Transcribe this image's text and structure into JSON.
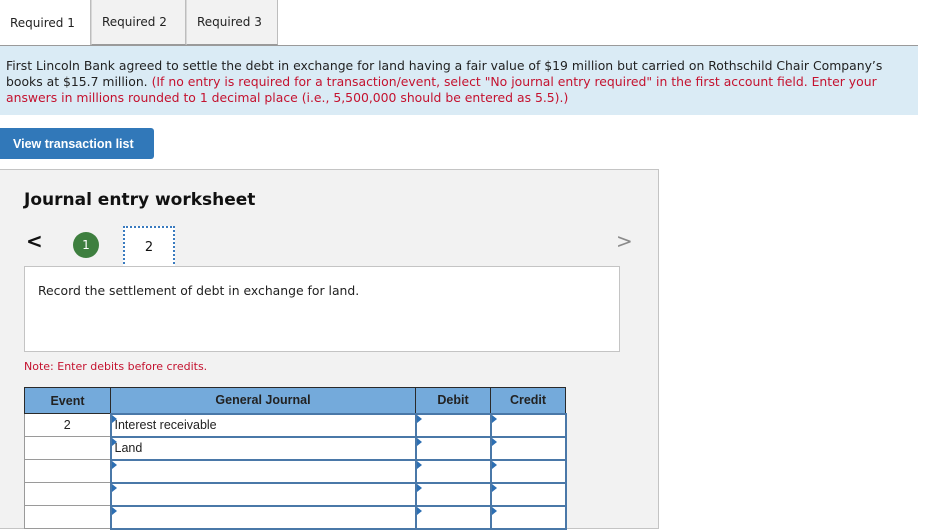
{
  "tabs": [
    {
      "label": "Required 1",
      "active": true
    },
    {
      "label": "Required 2",
      "active": false
    },
    {
      "label": "Required 3",
      "active": false
    }
  ],
  "instructions": {
    "main_text": "First Lincoln Bank agreed to settle the debt in exchange for land having a fair value of $19 million but carried on Rothschild Chair Company’s books at $15.7 million.",
    "red_text": "(If no entry is required for a transaction/event, select \"No journal entry required\" in the first account field. Enter your answers in millions rounded to 1 decimal place (i.e., 5,500,000 should be entered as 5.5).)"
  },
  "view_transaction_button": "View transaction list",
  "worksheet": {
    "title": "Journal entry worksheet",
    "prev_icon": "<",
    "next_icon": ">",
    "steps": [
      {
        "label": "1",
        "state": "completed"
      },
      {
        "label": "2",
        "state": "current"
      }
    ],
    "description": "Record the settlement of debt in exchange for land.",
    "note": "Note: Enter debits before credits.",
    "colors": {
      "step_completed": "#3e7f3f",
      "header_bg": "#74aadb",
      "note_red": "#c4122f"
    }
  },
  "journal": {
    "headers": [
      "Event",
      "General Journal",
      "Debit",
      "Credit"
    ],
    "rows": [
      {
        "event": "2",
        "account": "Interest receivable",
        "debit": "",
        "credit": ""
      },
      {
        "event": "",
        "account": "Land",
        "debit": "",
        "credit": ""
      },
      {
        "event": "",
        "account": "",
        "debit": "",
        "credit": ""
      },
      {
        "event": "",
        "account": "",
        "debit": "",
        "credit": ""
      },
      {
        "event": "",
        "account": "",
        "debit": "",
        "credit": ""
      }
    ]
  }
}
